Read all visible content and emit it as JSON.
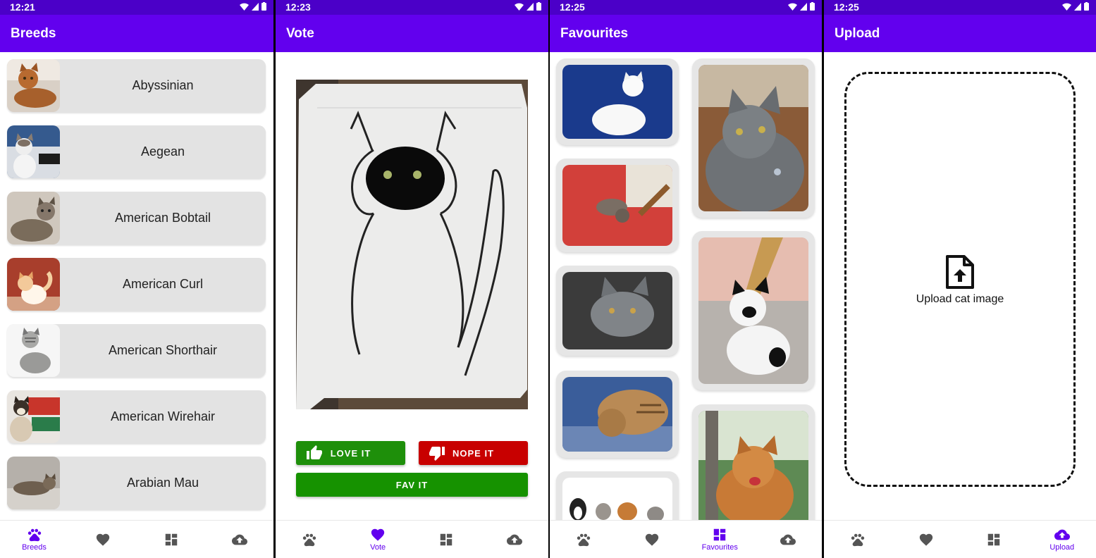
{
  "colors": {
    "primary": "#6200ee",
    "status_bar": "#4b00c8",
    "love": "#1e8f0a",
    "nope": "#c80000",
    "fav": "#169200"
  },
  "bottom_nav": {
    "breeds_label": "Breeds",
    "vote_label": "Vote",
    "favourites_label": "Favourites",
    "upload_label": "Upload",
    "icons": [
      "paw-icon",
      "heart-icon",
      "dashboard-icon",
      "cloud-upload-icon"
    ]
  },
  "screens": [
    {
      "time": "12:21",
      "title": "Breeds",
      "active_tab": "Breeds",
      "breeds": [
        "Abyssinian",
        "Aegean",
        "American Bobtail",
        "American Curl",
        "American Shorthair",
        "American Wirehair",
        "Arabian Mau"
      ]
    },
    {
      "time": "12:23",
      "title": "Vote",
      "active_tab": "Vote",
      "love_label": "LOVE IT",
      "nope_label": "NOPE IT",
      "fav_label": "FAV IT"
    },
    {
      "time": "12:25",
      "title": "Favourites",
      "active_tab": "Favourites",
      "favourite_count_visible": 8
    },
    {
      "time": "12:25",
      "title": "Upload",
      "active_tab": "Upload",
      "upload_prompt": "Upload cat image"
    }
  ]
}
